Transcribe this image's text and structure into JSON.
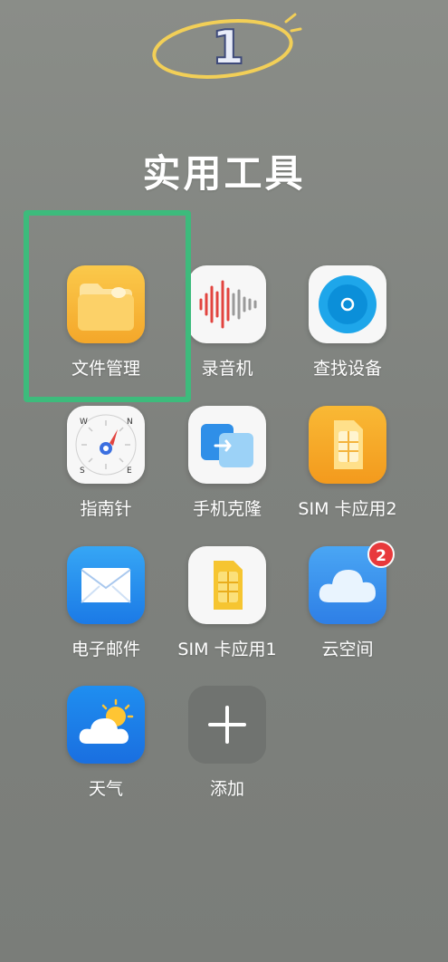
{
  "annotation": {
    "step_number": "1"
  },
  "folder": {
    "title": "实用工具"
  },
  "apps": [
    {
      "label": "文件管理"
    },
    {
      "label": "录音机"
    },
    {
      "label": "查找设备"
    },
    {
      "label": "指南针"
    },
    {
      "label": "手机克隆"
    },
    {
      "label": "SIM 卡应用2"
    },
    {
      "label": "电子邮件"
    },
    {
      "label": "SIM 卡应用1"
    },
    {
      "label": "云空间",
      "badge": "2"
    },
    {
      "label": "天气"
    },
    {
      "label": "添加"
    }
  ],
  "compass": {
    "n": "N",
    "w": "W",
    "s": "S",
    "e": "E"
  },
  "colors": {
    "highlight": "#3dbb7c",
    "annotation": "#f2cf57",
    "badge": "#e8393c"
  }
}
